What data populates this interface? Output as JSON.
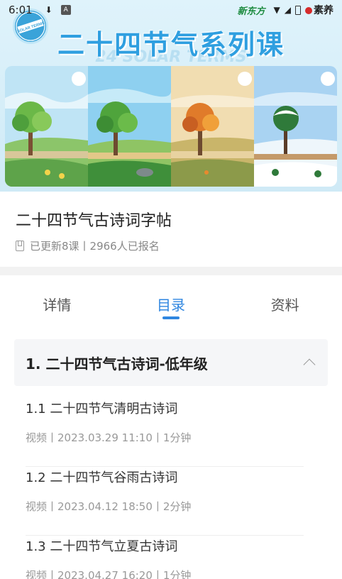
{
  "status_bar": {
    "time": "6:01",
    "icons": [
      "download-icon",
      "app-a-icon",
      "wifi-icon",
      "signal-icon",
      "battery-icon"
    ],
    "brand_left": "新东方",
    "brand_right": "素养"
  },
  "banner": {
    "title": "二十四节气系列课",
    "subtitle": "24 SOLAR TERMS",
    "seal_text": "SOLAR TERMS",
    "panels": [
      "spring",
      "summer",
      "autumn",
      "winter"
    ]
  },
  "course": {
    "title": "二十四节气古诗词字帖",
    "meta": "已更新8课丨2966人已报名"
  },
  "tabs": [
    {
      "label": "详情",
      "active": false
    },
    {
      "label": "目录",
      "active": true
    },
    {
      "label": "资料",
      "active": false
    }
  ],
  "section": {
    "title": "1. 二十四节气古诗词-低年级"
  },
  "lessons": [
    {
      "title": "1.1 二十四节气清明古诗词",
      "meta": "视频丨2023.03.29 11:10丨1分钟"
    },
    {
      "title": "1.2 二十四节气谷雨古诗词",
      "meta": "视频丨2023.04.12 18:50丨2分钟"
    },
    {
      "title": "1.3 二十四节气立夏古诗词",
      "meta": "视频丨2023.04.27 16:20丨1分钟"
    }
  ],
  "colors": {
    "accent": "#2f86e0",
    "banner_title": "#2f9fe0"
  }
}
